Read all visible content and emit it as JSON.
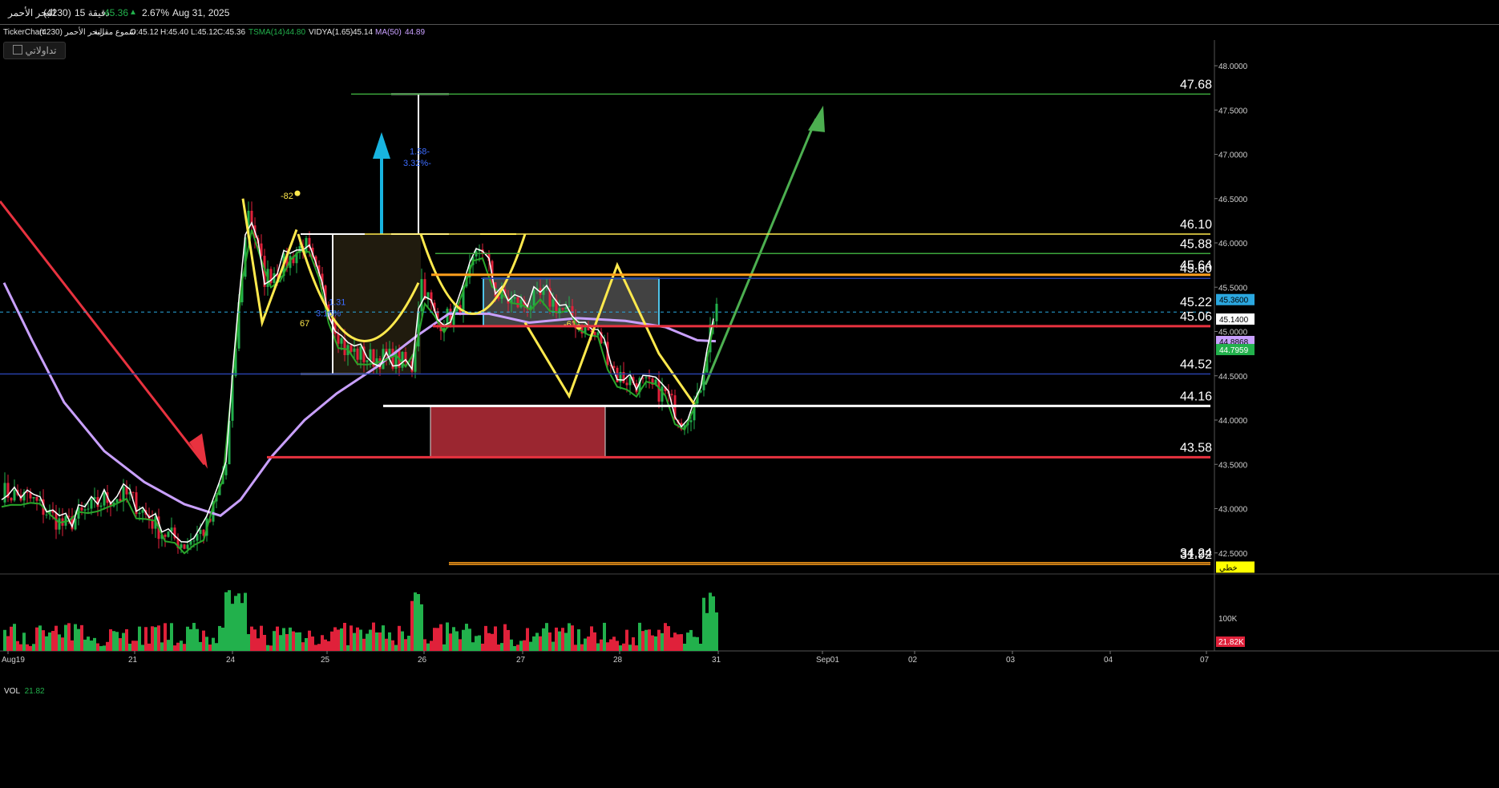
{
  "header": {
    "symbol": "البحر الأحمر",
    "code": "(4230)",
    "interval": "15 دقيقة",
    "price": "45.36",
    "change": "2.67%",
    "date": "Aug 31, 2025"
  },
  "info": {
    "source": "TickerChart",
    "name": "البحر الأحمر (4230)",
    "candles": "شموع مقرنة",
    "open": "O:45.12",
    "high": "H:45.40",
    "low": "L:45.12",
    "close": "C:45.36",
    "tsma": "TSMA(14)",
    "tsma_val": "44.80",
    "vidya": "VIDYA(1.65)",
    "vidya_val": "45.14",
    "ma": "MA(50)",
    "ma_val": "44.89"
  },
  "brand": {
    "label": "تداولاتي"
  },
  "volume": {
    "label": "VOL",
    "value": "21.82"
  },
  "colors": {
    "up": "#22b14c",
    "down": "#e0213a",
    "tsma": "#2aa52a",
    "ma": "#c9a0ff",
    "vidya": "#ffffff",
    "support": "#e8323f",
    "resistance": "#ffe94d",
    "orange": "#ff9f1c",
    "blue": "#2740a8",
    "arrow_up": "#4caf50",
    "arrow_down": "#e8323f"
  },
  "chart_data": {
    "type": "candlestick",
    "ylim": [
      42.25,
      48.3
    ],
    "y_ticks": [
      "48.0000",
      "47.5000",
      "47.0000",
      "46.5000",
      "46.0000",
      "45.5000",
      "45.0000",
      "44.5000",
      "44.0000",
      "43.5000",
      "43.0000",
      "42.5000"
    ],
    "x_ticks": [
      "Aug19",
      "21",
      "24",
      "25",
      "26",
      "27",
      "28",
      "31",
      "Sep01",
      "02",
      "03",
      "04",
      "07"
    ],
    "price_levels": [
      {
        "label": "47.68",
        "value": 47.68,
        "color": "#3ca63c"
      },
      {
        "label": "46.10",
        "value": 46.1,
        "color": "#ffe94d"
      },
      {
        "label": "45.88",
        "value": 45.88,
        "color": "#3ca63c"
      },
      {
        "label": "45.64",
        "value": 45.64,
        "color": "#ff9f1c"
      },
      {
        "label": "45.60",
        "value": 45.6,
        "color": "#2740a8"
      },
      {
        "label": "45.22",
        "value": 45.22,
        "color": "#2740a8"
      },
      {
        "label": "45.06",
        "value": 45.06,
        "color": "#e8323f"
      },
      {
        "label": "44.52",
        "value": 44.52,
        "color": "#2740a8"
      },
      {
        "label": "44.16",
        "value": 44.16,
        "color": "#ffffff"
      },
      {
        "label": "43.58",
        "value": 43.58,
        "color": "#e8323f"
      },
      {
        "label": "34.24",
        "value": 42.39,
        "color": "#ff9f1c"
      },
      {
        "label": "31.92",
        "value": 42.37,
        "color": "#ff9f1c"
      }
    ],
    "axis_tags": [
      {
        "label": "45.3600",
        "value": 45.36,
        "bg": "#2ba8e0",
        "fg": "#000"
      },
      {
        "label": "45.1400",
        "value": 45.14,
        "bg": "#ffffff",
        "fg": "#000"
      },
      {
        "label": "44.8868",
        "value": 44.8868,
        "bg": "#c9a0ff",
        "fg": "#000"
      },
      {
        "label": "44.7959",
        "value": 44.7959,
        "bg": "#22b14c",
        "fg": "#fff"
      },
      {
        "label": "خطي",
        "value": 42.34,
        "bg": "#ffff00",
        "fg": "#000"
      }
    ],
    "annotations": [
      {
        "text": "-82",
        "color": "#ffe94d"
      },
      {
        "text": "67",
        "color": "#ffe94d"
      },
      {
        "text": "-61",
        "color": "#ffe94d"
      },
      {
        "text": "1.58-",
        "color": "#3c6cff"
      },
      {
        "text": "3.32%-",
        "color": "#3c6cff"
      },
      {
        "text": "1.31",
        "color": "#3c6cff"
      },
      {
        "text": "3.16%",
        "color": "#3c6cff"
      }
    ],
    "volume_ticks": [
      "100K"
    ],
    "volume_tag": "21.82K",
    "series": [
      {
        "name": "TSMA(14)",
        "last": 44.8
      },
      {
        "name": "VIDYA(1.65)",
        "last": 45.14
      },
      {
        "name": "MA(50)",
        "last": 44.89
      }
    ]
  }
}
